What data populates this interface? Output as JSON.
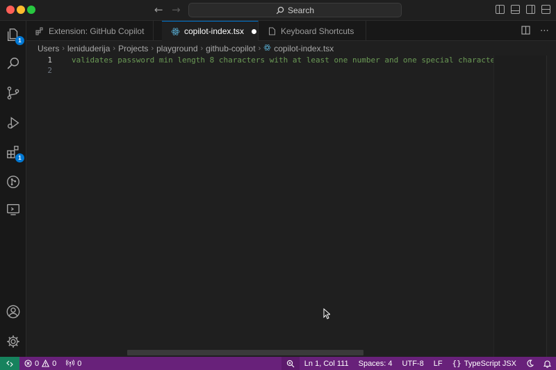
{
  "titlebar": {
    "search_label": "Search"
  },
  "activity_bar": {
    "explorer_badge": "1",
    "extensions_badge": "1"
  },
  "tabs": [
    {
      "label": "Extension: GitHub Copilot",
      "active": false
    },
    {
      "label": "copilot-index.tsx",
      "active": true,
      "modified": true
    },
    {
      "label": "Keyboard Shortcuts",
      "active": false
    }
  ],
  "breadcrumb": [
    "Users",
    "leniduderija",
    "Projects",
    "playground",
    "github-copilot",
    "copilot-index.tsx"
  ],
  "editor": {
    "lines": [
      {
        "number": "1",
        "text": "validates password min length 8 characters with at least one number and one special character"
      },
      {
        "number": "2",
        "text": ""
      }
    ]
  },
  "statusbar": {
    "errors": "0",
    "warnings": "0",
    "ports": "0",
    "position": "Ln 1, Col 111",
    "spaces": "Spaces: 4",
    "encoding": "UTF-8",
    "eol": "LF",
    "language": "TypeScript JSX"
  },
  "colors": {
    "status_bar": "#68217a",
    "remote_indicator": "#16825d",
    "accent": "#0078d4",
    "comment": "#6a9955"
  }
}
